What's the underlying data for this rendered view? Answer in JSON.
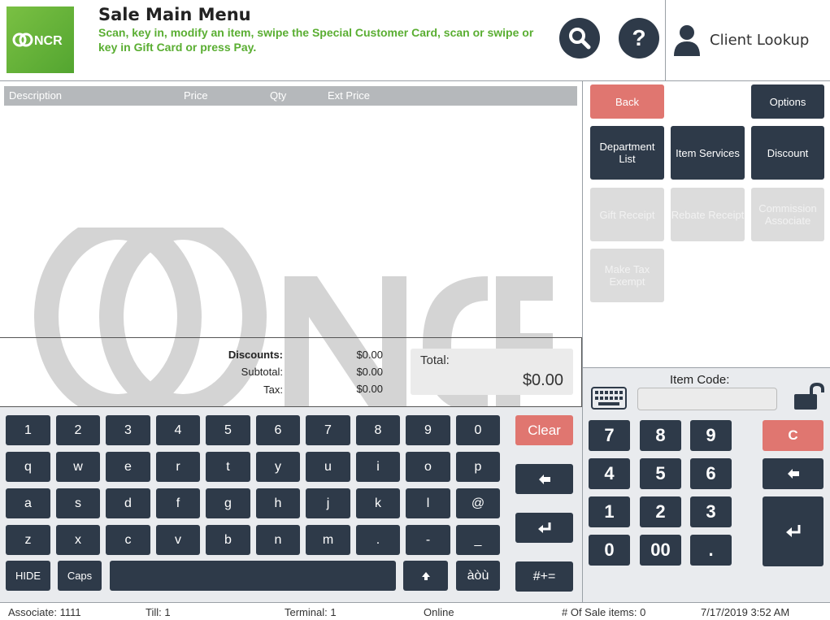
{
  "header": {
    "title": "Sale Main Menu",
    "subtitle": "Scan, key in, modify an item, swipe the Special Customer Card, scan or swipe or key in Gift Card or press Pay.",
    "logo_text": "NCR",
    "client_lookup_label": "Client Lookup",
    "help_label": "?"
  },
  "columns": [
    "Description",
    "Price",
    "Qty",
    "Ext Price"
  ],
  "totals": {
    "discounts_label": "Discounts:",
    "discounts_value": "$0.00",
    "subtotal_label": "Subtotal:",
    "subtotal_value": "$0.00",
    "tax_label": "Tax:",
    "tax_value": "$0.00",
    "total_label": "Total:",
    "total_value": "$0.00"
  },
  "functions": {
    "back": "Back",
    "options": "Options",
    "department_list": "Department List",
    "item_services": "Item Services",
    "discount": "Discount",
    "gift_receipt": "Gift Receipt",
    "rebate_receipt": "Rebate Receipt",
    "commission_associate": "Commission Associate",
    "make_tax_exempt": "Make Tax Exempt"
  },
  "keyboard": {
    "row1": [
      "1",
      "2",
      "3",
      "4",
      "5",
      "6",
      "7",
      "8",
      "9",
      "0"
    ],
    "row2": [
      "q",
      "w",
      "e",
      "r",
      "t",
      "y",
      "u",
      "i",
      "o",
      "p"
    ],
    "row3": [
      "a",
      "s",
      "d",
      "f",
      "g",
      "h",
      "j",
      "k",
      "l",
      "@"
    ],
    "row4": [
      "z",
      "x",
      "c",
      "v",
      "b",
      "n",
      "m",
      ".",
      "-",
      "_"
    ],
    "hide": "HIDE",
    "caps": "Caps",
    "accents": "àòù",
    "clear": "Clear",
    "symbols": "#+="
  },
  "numpad": {
    "item_code_label": "Item Code:",
    "item_code_value": "",
    "keys": [
      "7",
      "8",
      "9",
      "4",
      "5",
      "6",
      "1",
      "2",
      "3",
      "0",
      "00",
      "."
    ],
    "clear": "C"
  },
  "status": {
    "associate": "Associate: 1111",
    "till": "Till: 1",
    "terminal": "Terminal: 1",
    "connection": "Online",
    "sale_items": "# Of Sale items: 0",
    "datetime": "7/17/2019 3:52 AM"
  },
  "colors": {
    "dark_button": "#2e3a49",
    "red_button": "#e07670",
    "brand_green": "#5aae32",
    "disabled_button": "#dcdcdc"
  },
  "icons": {
    "search": "search-icon",
    "help": "help-icon",
    "client": "person-icon",
    "keyboard": "keyboard-icon",
    "lock": "unlock-icon",
    "backspace": "arrow-left-icon",
    "enter": "enter-icon",
    "shift": "arrow-up-icon"
  }
}
